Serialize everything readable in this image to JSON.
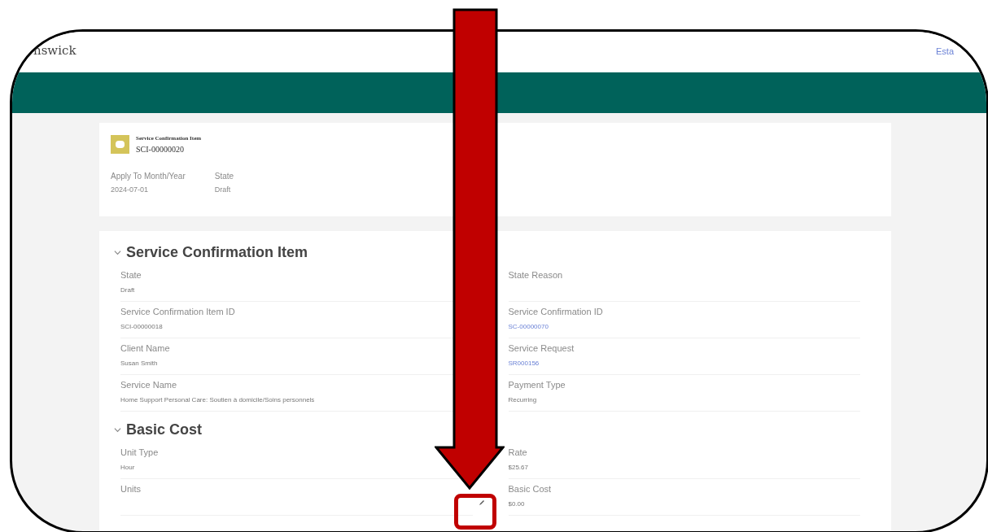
{
  "header": {
    "logo": "nswick",
    "link": "Esta"
  },
  "record": {
    "type": "Service Confirmation Item",
    "name": "SCI-00000020",
    "fields": [
      {
        "label": "Apply To Month/Year",
        "value": "2024-07-01"
      },
      {
        "label": "State",
        "value": "Draft"
      }
    ]
  },
  "sections": [
    {
      "title": "Service Confirmation Item",
      "expanded": true,
      "fields": [
        {
          "label": "State",
          "value": "Draft"
        },
        {
          "label": "State Reason"
        },
        {
          "label": "Service Confirmation Item ID",
          "value": "SCI-00000018"
        },
        {
          "label": "Service Confirmation ID",
          "value": "SC-00000070",
          "link": true
        },
        {
          "label": "Client Name",
          "value": "Susan Smith"
        },
        {
          "label": "Service Request",
          "value": "SR000156",
          "link": true
        },
        {
          "label": "Service Name",
          "value": "Home Support Personal Care: Soutien à domicile/Soins personnels"
        },
        {
          "label": "Payment Type",
          "value": "Recurring"
        }
      ]
    },
    {
      "title": "Basic Cost",
      "expanded": true,
      "fields": [
        {
          "label": "Unit Type",
          "value": "Hour"
        },
        {
          "label": "Rate",
          "value": "$25.67"
        },
        {
          "label": "Units",
          "editable": true
        },
        {
          "label": "Basic Cost",
          "value": "$0.00"
        }
      ]
    }
  ]
}
